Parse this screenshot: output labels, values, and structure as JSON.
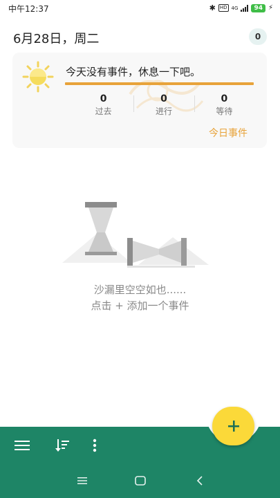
{
  "status_bar": {
    "time": "中午12:37",
    "network": "4G",
    "battery": "94"
  },
  "header": {
    "date": "6月28日，周二",
    "event_count": "0"
  },
  "summary_card": {
    "message": "今天没有事件，休息一下吧。",
    "stats": [
      {
        "value": "0",
        "label": "过去"
      },
      {
        "value": "0",
        "label": "进行"
      },
      {
        "value": "0",
        "label": "等待"
      }
    ],
    "today_link": "今日事件"
  },
  "empty_state": {
    "line1": "沙漏里空空如也......",
    "line2": "点击 + 添加一个事件"
  },
  "colors": {
    "primary": "#1e8566",
    "accent": "#e8a33a",
    "fab": "#fbd939"
  },
  "icons": {
    "fab": "plus-icon",
    "menu": "hamburger-icon",
    "sort": "sort-icon",
    "more": "more-vertical-icon"
  }
}
